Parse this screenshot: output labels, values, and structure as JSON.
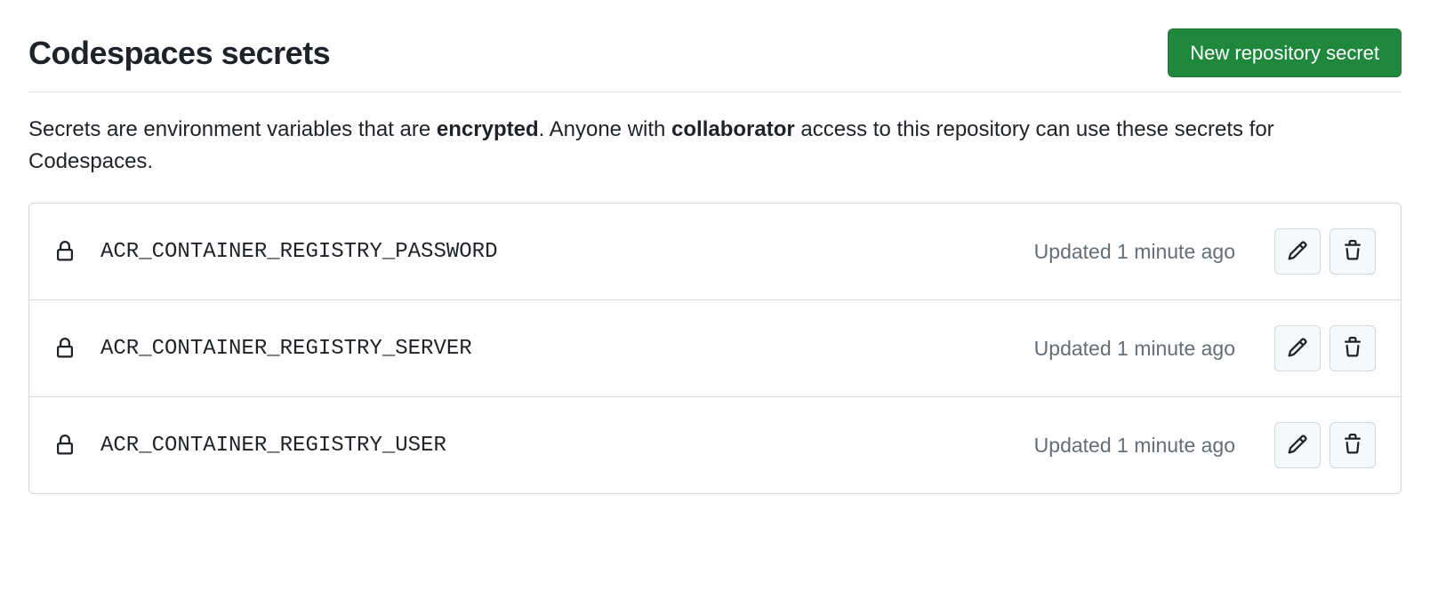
{
  "header": {
    "title": "Codespaces secrets",
    "new_secret_button": "New repository secret"
  },
  "description": {
    "prefix": "Secrets are environment variables that are ",
    "bold1": "encrypted",
    "mid": ". Anyone with ",
    "bold2": "collaborator",
    "suffix": " access to this repository can use these secrets for Codespaces."
  },
  "secrets": [
    {
      "name": "ACR_CONTAINER_REGISTRY_PASSWORD",
      "updated": "Updated 1 minute ago"
    },
    {
      "name": "ACR_CONTAINER_REGISTRY_SERVER",
      "updated": "Updated 1 minute ago"
    },
    {
      "name": "ACR_CONTAINER_REGISTRY_USER",
      "updated": "Updated 1 minute ago"
    }
  ]
}
